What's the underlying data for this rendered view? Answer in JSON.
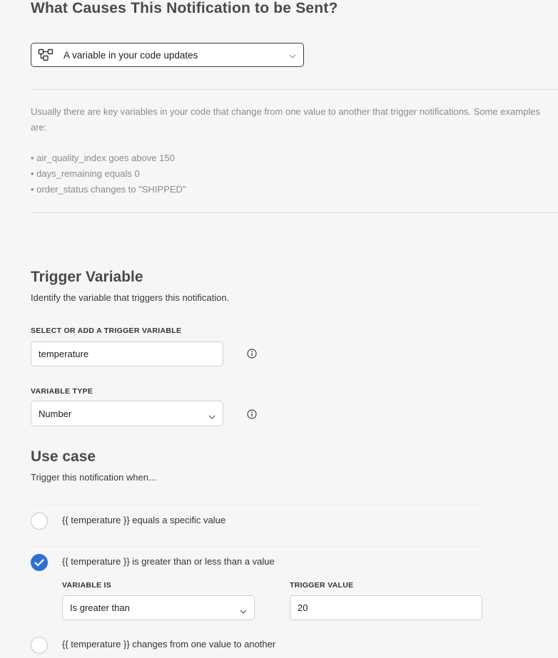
{
  "header": {
    "title": "What Causes This Notification to be Sent?"
  },
  "trigger_source": {
    "icon": "flow-diagram-icon",
    "selected": "A variable in your code updates"
  },
  "description": {
    "text": "Usually there are key variables in your code that change from one value to another that trigger notifications. Some examples are:",
    "examples": [
      "• air_quality_index goes above 150",
      "• days_remaining equals 0",
      "• order_status changes to \"SHIPPED\""
    ]
  },
  "trigger_variable": {
    "heading": "Trigger Variable",
    "subtitle": "Identify the variable that triggers this notification.",
    "select_label": "SELECT OR ADD A TRIGGER VARIABLE",
    "select_value": "temperature",
    "type_label": "VARIABLE TYPE",
    "type_value": "Number"
  },
  "use_case": {
    "heading": "Use case",
    "subtitle": "Trigger this notification when...",
    "options": [
      {
        "label": "{{ temperature }} equals a specific value",
        "checked": false
      },
      {
        "label": "{{ temperature }} is greater than or less than a value",
        "checked": true
      },
      {
        "label": "{{ temperature }} changes from one value to another",
        "checked": false
      }
    ],
    "comparison": {
      "variable_is_label": "VARIABLE IS",
      "variable_is_value": "Is greater than",
      "trigger_value_label": "TRIGGER VALUE",
      "trigger_value": "20"
    }
  },
  "colors": {
    "accent": "#2f6fd1",
    "background": "#f6f6f6"
  }
}
